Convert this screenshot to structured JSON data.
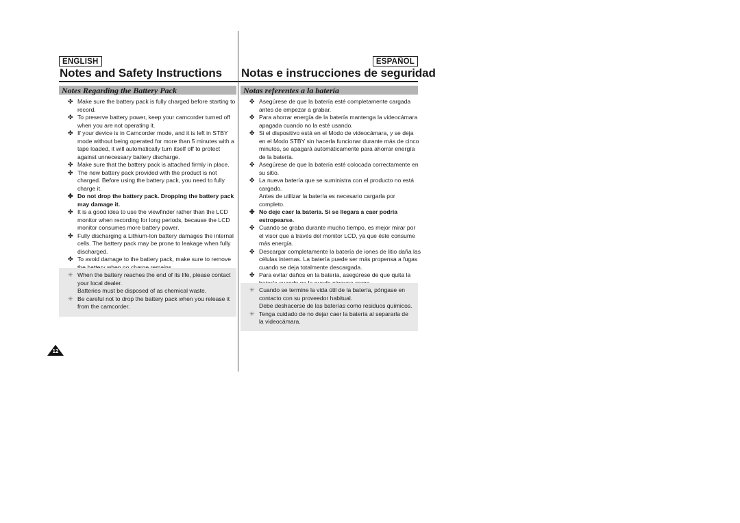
{
  "english": {
    "lang_label": "ENGLISH",
    "title": "Notes and Safety Instructions",
    "section": "Notes Regarding the Battery Pack",
    "items": [
      {
        "text": "Make sure the battery pack is fully charged before starting to record.",
        "bold": false
      },
      {
        "text": "To preserve battery power, keep your camcorder turned off when you are not operating it.",
        "bold": false
      },
      {
        "text": "If your device is in Camcorder mode, and it is left in STBY mode without being operated for more than 5 minutes with a tape loaded, it will automatically turn itself off to protect against unnecessary battery discharge.",
        "bold": false
      },
      {
        "text": "Make sure that the battery pack is attached firmly in place.",
        "bold": false
      },
      {
        "text": "The new battery pack provided with the product is not charged. Before using the battery pack, you need to fully charge it.",
        "bold": false
      },
      {
        "text": "Do not drop the battery pack. Dropping the battery pack may damage it.",
        "bold": true
      },
      {
        "text": "It is a good idea to use the viewfinder rather than the LCD monitor when recording for long periods, because the LCD monitor consumes more battery power.",
        "bold": false
      },
      {
        "text": "Fully discharging a Lithium-Ion battery damages the internal cells. The battery pack may be prone to leakage when fully discharged.",
        "bold": false
      },
      {
        "text": "To avoid damage to the battery pack, make sure to remove the battery when no charge remains.",
        "bold": false
      }
    ],
    "notes": [
      {
        "text": "When the battery reaches the end of its life, please contact your local dealer.",
        "extra": "Batteries must be disposed of as chemical waste."
      },
      {
        "text": "Be careful not to drop the battery pack when you release it from the camcorder.",
        "extra": ""
      }
    ]
  },
  "spanish": {
    "lang_label": "ESPAÑOL",
    "title": "Notas e instrucciones de seguridad",
    "section": "Notas referentes a la batería",
    "items": [
      {
        "text": "Asegúrese de que la batería esté completamente cargada antes de empezar a grabar.",
        "bold": false,
        "extra": ""
      },
      {
        "text": "Para ahorrar energía de la batería mantenga la videocámara apagada cuando no la esté usando.",
        "bold": false,
        "extra": ""
      },
      {
        "text": "Si el dispositivo está en el Modo de videocámara, y se deja en el Modo STBY sin hacerla funcionar durante más de cinco minutos, se apagará automáticamente para ahorrar energía de la batería.",
        "bold": false,
        "extra": ""
      },
      {
        "text": "Asegúrese de que la batería esté colocada correctamente en su sitio.",
        "bold": false,
        "extra": ""
      },
      {
        "text": "La nueva batería que se suministra con el producto no está cargado.",
        "bold": false,
        "extra": "Antes de utilizar la batería es necesario cargarla por completo."
      },
      {
        "text": "No deje caer la batería. Si se llegara a caer podría estropearse.",
        "bold": true,
        "extra": ""
      },
      {
        "text": "Cuando se graba durante mucho tiempo, es mejor mirar por el visor que a través del monitor LCD, ya que éste consume más energía.",
        "bold": false,
        "extra": ""
      },
      {
        "text": "Descargar completamente la batería de iones de litio daña las células internas. La batería puede ser más propensa a fugas cuando se deja totalmente descargada.",
        "bold": false,
        "extra": ""
      },
      {
        "text": "Para evitar daños en la batería, asegúrese de que quita la batería cuando no le quede ninguna carga.",
        "bold": false,
        "extra": ""
      }
    ],
    "notes": [
      {
        "text": "Cuando se termine la vida útil de la batería, póngase en contacto con su proveedor habitual.",
        "extra": "Debe deshacerse de las baterías como residuos químicos."
      },
      {
        "text": "Tenga cuidado de no dejar caer la batería al separarla de la videocámara.",
        "extra": ""
      }
    ]
  },
  "page_number": "12",
  "bullet_glyph": "✤",
  "note_glyph": "✳"
}
